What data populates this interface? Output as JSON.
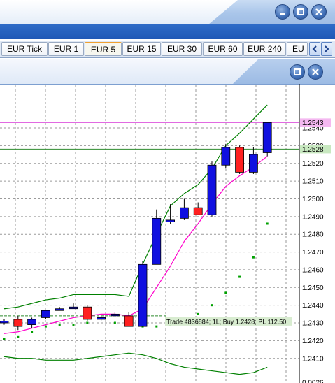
{
  "tabs": [
    {
      "label": "EUR Tick",
      "active": false
    },
    {
      "label": "EUR 1",
      "active": false
    },
    {
      "label": "EUR 5",
      "active": true
    },
    {
      "label": "EUR 15",
      "active": false
    },
    {
      "label": "EUR 30",
      "active": false
    },
    {
      "label": "EUR 60",
      "active": false
    },
    {
      "label": "EUR 240",
      "active": false
    },
    {
      "label": "EU",
      "active": false
    }
  ],
  "price_axis": {
    "labels": [
      "1.2540",
      "1.2530",
      "1.2520",
      "1.2510",
      "1.2500",
      "1.2490",
      "1.2480",
      "1.2470",
      "1.2460",
      "1.2450",
      "1.2440",
      "1.2430",
      "1.2420",
      "1.2410",
      "0.0026"
    ],
    "current_price_tag": "1.2543",
    "trade_price_tag": "1.2528"
  },
  "trade_label": "Trade 4836884; 1L; Buy 1.2428; PL 112.50",
  "colors": {
    "bull": "#1010e0",
    "bear": "#ff2020",
    "doji": "#cc2020",
    "wick": "#000000",
    "upper_band": "#008000",
    "lower_band": "#008000",
    "ma": "#ff00cc",
    "sar": "#00a000",
    "current_line": "#dd55dd",
    "trade_line": "#2e8b2e"
  },
  "chart_data": {
    "type": "candlestick",
    "y_range": [
      1.2404,
      1.2553
    ],
    "candles": [
      {
        "o": 1.2431,
        "h": 1.2432,
        "l": 1.2429,
        "c": 1.2431
      },
      {
        "o": 1.2432,
        "h": 1.2434,
        "l": 1.2426,
        "c": 1.2428
      },
      {
        "o": 1.2429,
        "h": 1.2433,
        "l": 1.2427,
        "c": 1.2432
      },
      {
        "o": 1.2433,
        "h": 1.2437,
        "l": 1.2432,
        "c": 1.2437
      },
      {
        "o": 1.2438,
        "h": 1.2439,
        "l": 1.2437,
        "c": 1.2438
      },
      {
        "o": 1.2439,
        "h": 1.2441,
        "l": 1.2438,
        "c": 1.2439
      },
      {
        "o": 1.2439,
        "h": 1.244,
        "l": 1.2431,
        "c": 1.2432
      },
      {
        "o": 1.2432,
        "h": 1.2434,
        "l": 1.2431,
        "c": 1.2433
      },
      {
        "o": 1.2435,
        "h": 1.2436,
        "l": 1.2434,
        "c": 1.2435
      },
      {
        "o": 1.2434,
        "h": 1.2436,
        "l": 1.2428,
        "c": 1.2428
      },
      {
        "o": 1.2428,
        "h": 1.2465,
        "l": 1.2428,
        "c": 1.2463
      },
      {
        "o": 1.2463,
        "h": 1.2494,
        "l": 1.2463,
        "c": 1.2489
      },
      {
        "o": 1.2488,
        "h": 1.2497,
        "l": 1.2486,
        "c": 1.2488
      },
      {
        "o": 1.2489,
        "h": 1.25,
        "l": 1.2488,
        "c": 1.2495
      },
      {
        "o": 1.2495,
        "h": 1.2498,
        "l": 1.2492,
        "c": 1.2491
      },
      {
        "o": 1.2491,
        "h": 1.2521,
        "l": 1.249,
        "c": 1.2519
      },
      {
        "o": 1.2519,
        "h": 1.2531,
        "l": 1.2517,
        "c": 1.2529
      },
      {
        "o": 1.2529,
        "h": 1.253,
        "l": 1.2514,
        "c": 1.2515
      },
      {
        "o": 1.2515,
        "h": 1.2529,
        "l": 1.2514,
        "c": 1.2525
      },
      {
        "o": 1.2526,
        "h": 1.2543,
        "l": 1.2524,
        "c": 1.2543
      }
    ],
    "upper_band": [
      1.2438,
      1.2439,
      1.2441,
      1.2443,
      1.2444,
      1.2446,
      1.2446,
      1.2446,
      1.2446,
      1.2445,
      1.2463,
      1.248,
      1.2496,
      1.2503,
      1.2508,
      1.2517,
      1.253,
      1.2537,
      1.2545,
      1.2553
    ],
    "lower_band": [
      1.2411,
      1.241,
      1.241,
      1.2409,
      1.2409,
      1.2409,
      1.241,
      1.2411,
      1.2412,
      1.2413,
      1.2412,
      1.241,
      1.2407,
      1.2405,
      1.2404,
      1.2403,
      1.2402,
      1.2401,
      1.2402,
      1.2405
    ],
    "moving_average": [
      1.2424,
      1.2425,
      1.2427,
      1.2429,
      1.2431,
      1.2433,
      1.2434,
      1.2435,
      1.2435,
      1.2434,
      1.2438,
      1.245,
      1.2462,
      1.2476,
      1.2486,
      1.2497,
      1.2507,
      1.2513,
      1.2518,
      1.2524
    ],
    "sar": [
      1.2421,
      1.2422,
      1.2425,
      1.2428,
      1.2429,
      1.2429,
      1.243,
      1.2433,
      1.243,
      1.2429,
      1.2428,
      1.2428,
      1.2429,
      1.2432,
      1.2435,
      1.244,
      1.2447,
      1.2456,
      1.2467,
      1.2486
    ],
    "current_price": 1.2543,
    "trade_price": 1.2528
  }
}
